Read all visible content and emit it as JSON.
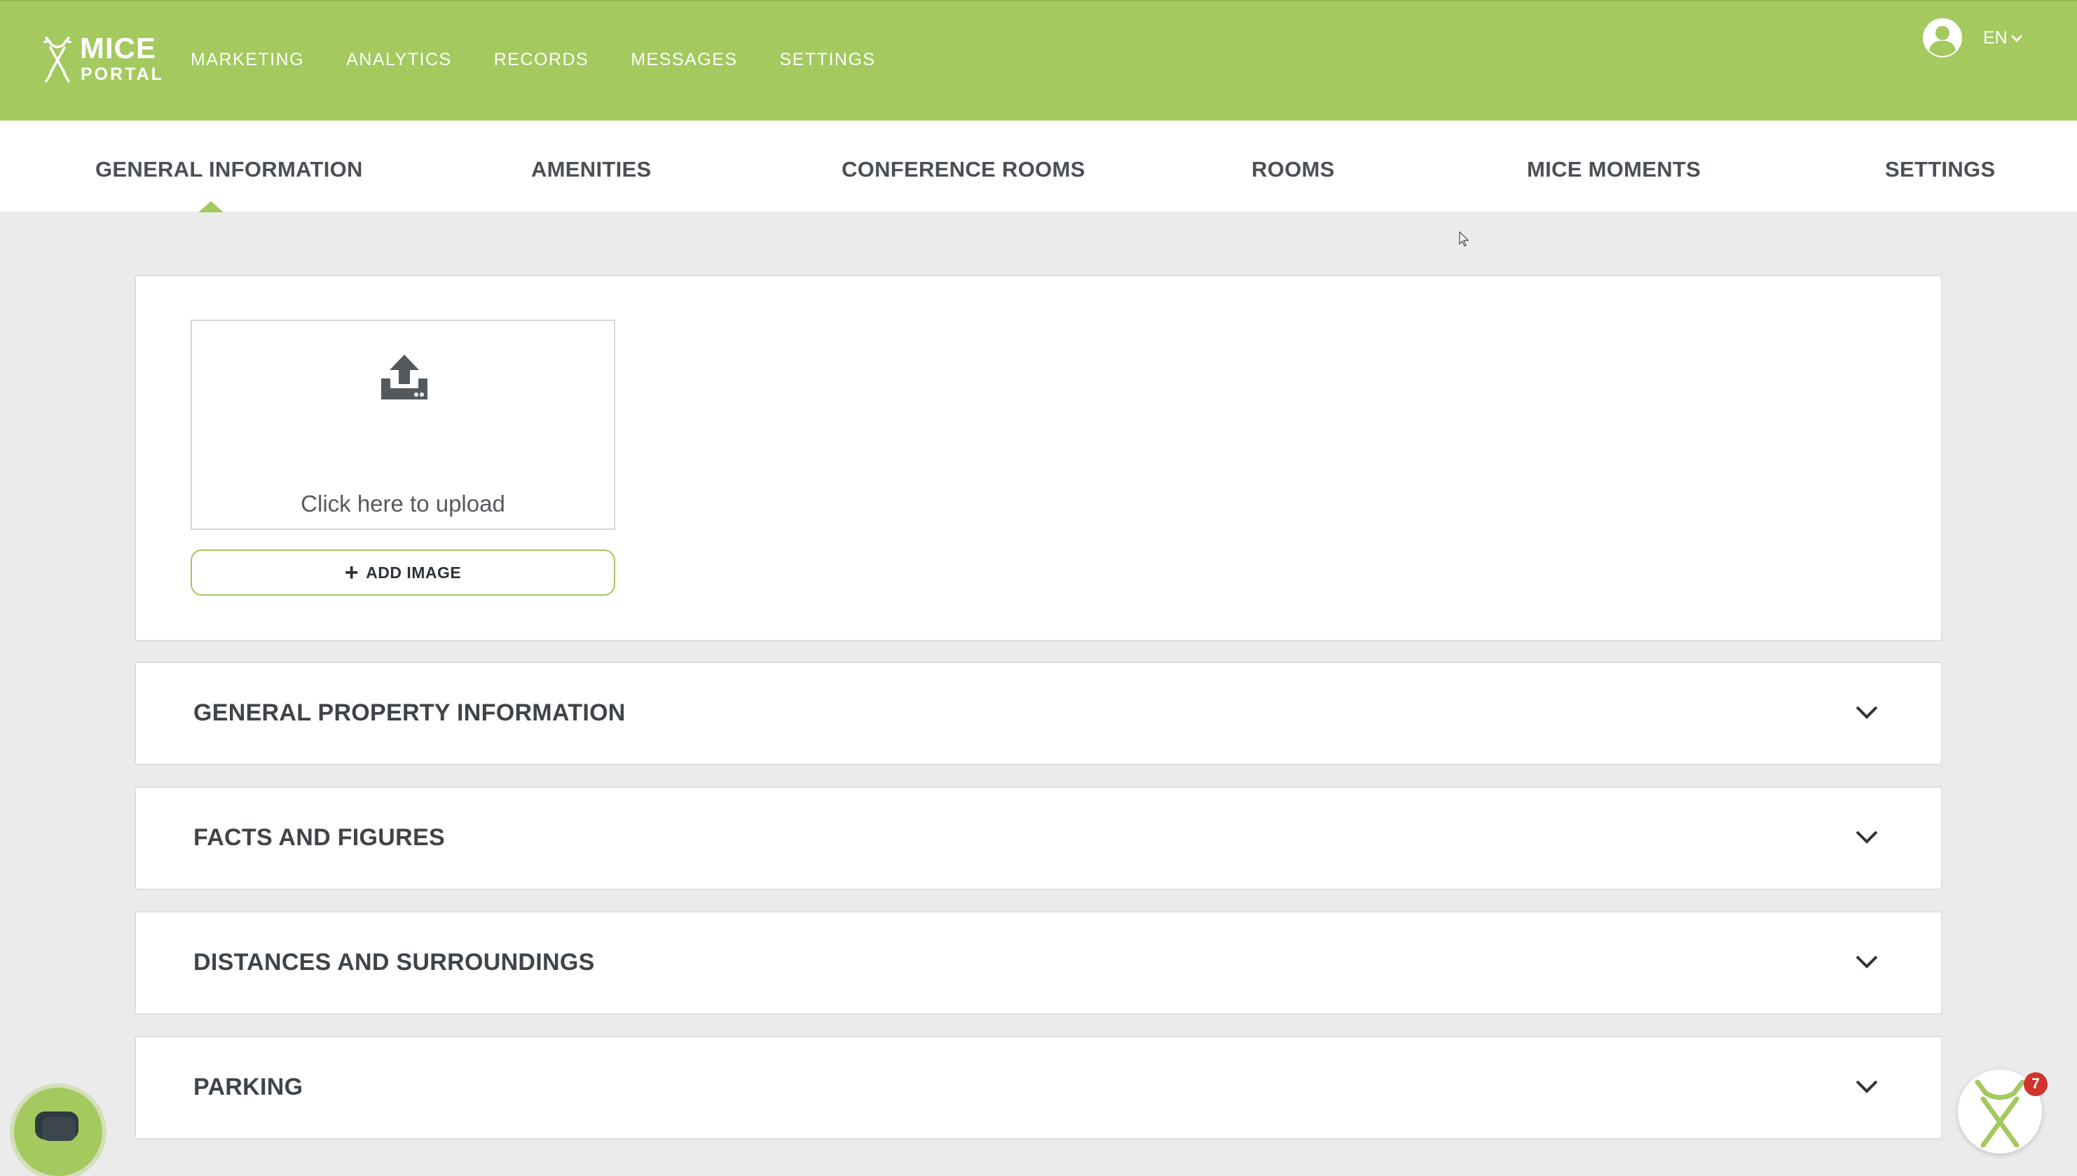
{
  "brand": {
    "line1": "MICE",
    "line2": "PORTAL"
  },
  "main_nav": [
    {
      "label": "MARKETING"
    },
    {
      "label": "ANALYTICS"
    },
    {
      "label": "RECORDS"
    },
    {
      "label": "MESSAGES"
    },
    {
      "label": "SETTINGS"
    }
  ],
  "user": {
    "icon": "user-circle-icon"
  },
  "language": {
    "current": "EN"
  },
  "sub_tabs": [
    {
      "label": "GENERAL INFORMATION",
      "active": true
    },
    {
      "label": "AMENITIES",
      "active": false
    },
    {
      "label": "CONFERENCE ROOMS",
      "active": false
    },
    {
      "label": "ROOMS",
      "active": false
    },
    {
      "label": "MICE MOMENTS",
      "active": false
    },
    {
      "label": "SETTINGS",
      "active": false
    }
  ],
  "upload": {
    "prompt": "Click here to upload",
    "add_button": "ADD IMAGE",
    "icon": "upload-icon"
  },
  "sections": [
    {
      "title": "GENERAL PROPERTY INFORMATION"
    },
    {
      "title": "FACTS AND FIGURES"
    },
    {
      "title": "DISTANCES AND SURROUNDINGS"
    },
    {
      "title": "PARKING"
    }
  ],
  "widgets": {
    "notification_count": "7"
  },
  "colors": {
    "brand_green": "#a3c95f",
    "background": "#ebebeb",
    "text_dark": "#3f4449",
    "badge_red": "#d0342c"
  }
}
